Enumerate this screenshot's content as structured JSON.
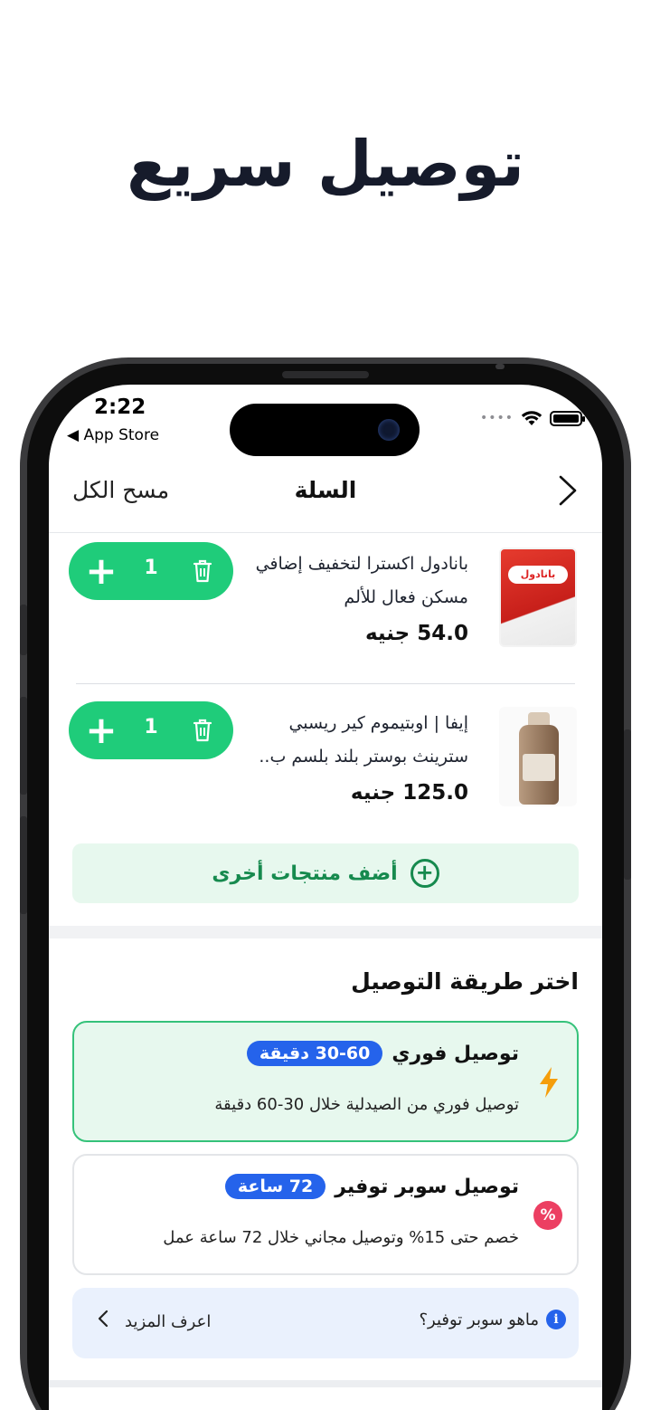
{
  "headline": "توصيل سريع",
  "status_bar": {
    "time": "2:22",
    "back_label": "◀ App Store"
  },
  "nav": {
    "clear_all": "مسح الكل",
    "title": "السلة",
    "back_icon": "chevron-right-icon"
  },
  "cart": {
    "items": [
      {
        "name": "بانادول اكسترا لتخفيف إضافي مسكن فعال للألم",
        "price": "54.0 جنيه",
        "quantity": "1",
        "thumb_brand": "بانادول"
      },
      {
        "name": "إيفا | اوبتيموم كير ريسبي سترينث بوستر بلند بلسم ب..",
        "price": "125.0 جنيه",
        "quantity": "1"
      }
    ],
    "add_more": "أضف منتجات أخرى"
  },
  "delivery": {
    "title": "اختر طريقة التوصيل",
    "options": [
      {
        "name": "توصيل فوري",
        "pill": "30-60 دقيقة",
        "desc": "توصيل فوري من الصيدلية خلال 30-60 دقيقة",
        "icon": "lightning-icon",
        "selected": true
      },
      {
        "name": "توصيل سوبر توفير",
        "pill": "72 ساعة",
        "desc": "خصم حتى 15% وتوصيل مجاني خلال 72 ساعة عمل",
        "icon": "percent-badge-icon",
        "selected": false
      }
    ],
    "info": {
      "question": "ماهو سوبر توفير؟",
      "learn_more": "اعرف المزيد"
    }
  },
  "colors": {
    "accent_green": "#1fcc7a",
    "accent_blue": "#2563eb",
    "bolt_orange": "#f59e0b",
    "badge_pink": "#ec3f62"
  }
}
